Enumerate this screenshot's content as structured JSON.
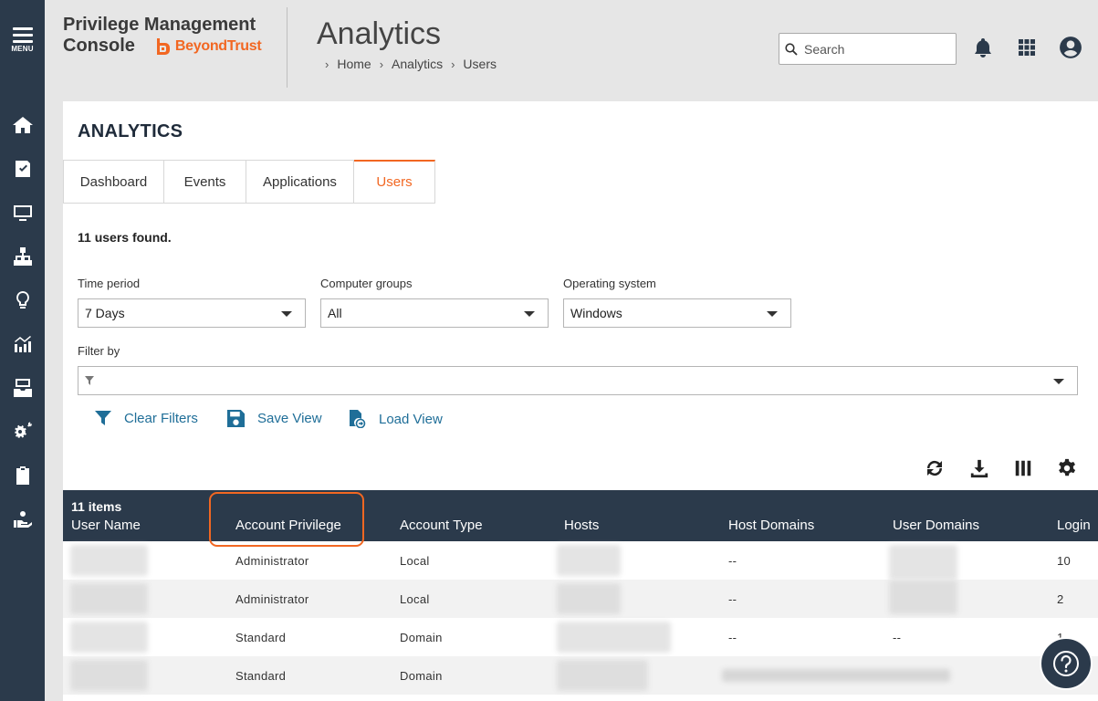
{
  "nav": {
    "menu_label": "MENU",
    "items": [
      "home-icon",
      "policy-icon",
      "computer-icon",
      "sitemap-icon",
      "lightbulb-icon",
      "analytics-icon",
      "inbox-icon",
      "settings-gears-icon",
      "clipboard-icon",
      "hand-icon"
    ]
  },
  "header": {
    "brand_line1": "Privilege Management",
    "brand_line2": "Console",
    "logo_text": "BeyondTrust",
    "title": "Analytics",
    "breadcrumb": [
      "Home",
      "Analytics",
      "Users"
    ],
    "search_placeholder": "Search"
  },
  "main": {
    "heading": "ANALYTICS",
    "tabs": [
      "Dashboard",
      "Events",
      "Applications",
      "Users"
    ],
    "active_tab": "Users",
    "found_text": "11 users found.",
    "filters": {
      "time_period": {
        "label": "Time period",
        "value": "7 Days"
      },
      "computer_groups": {
        "label": "Computer groups",
        "value": "All"
      },
      "operating_system": {
        "label": "Operating system",
        "value": "Windows"
      },
      "filter_by": {
        "label": "Filter by",
        "value": ""
      }
    },
    "actions": {
      "clear_filters": "Clear Filters",
      "save_view": "Save View",
      "load_view": "Load View"
    }
  },
  "table": {
    "items_count": "11 items",
    "columns": [
      "User Name",
      "Account Privilege",
      "Account Type",
      "Hosts",
      "Host Domains",
      "User Domains",
      "Login"
    ],
    "rows": [
      {
        "privilege": "Administrator",
        "type": "Local",
        "host_domains": "--",
        "user_domains": "",
        "login": "10"
      },
      {
        "privilege": "Administrator",
        "type": "Local",
        "host_domains": "--",
        "user_domains": "",
        "login": "2"
      },
      {
        "privilege": "Standard",
        "type": "Domain",
        "host_domains": "--",
        "user_domains": "--",
        "login": "1"
      },
      {
        "privilege": "Standard",
        "type": "Domain",
        "host_domains": "",
        "user_domains": "",
        "login": ""
      }
    ]
  },
  "colors": {
    "nav_bg": "#2b3a4b",
    "accent": "#f26722",
    "link": "#1f6e98"
  }
}
